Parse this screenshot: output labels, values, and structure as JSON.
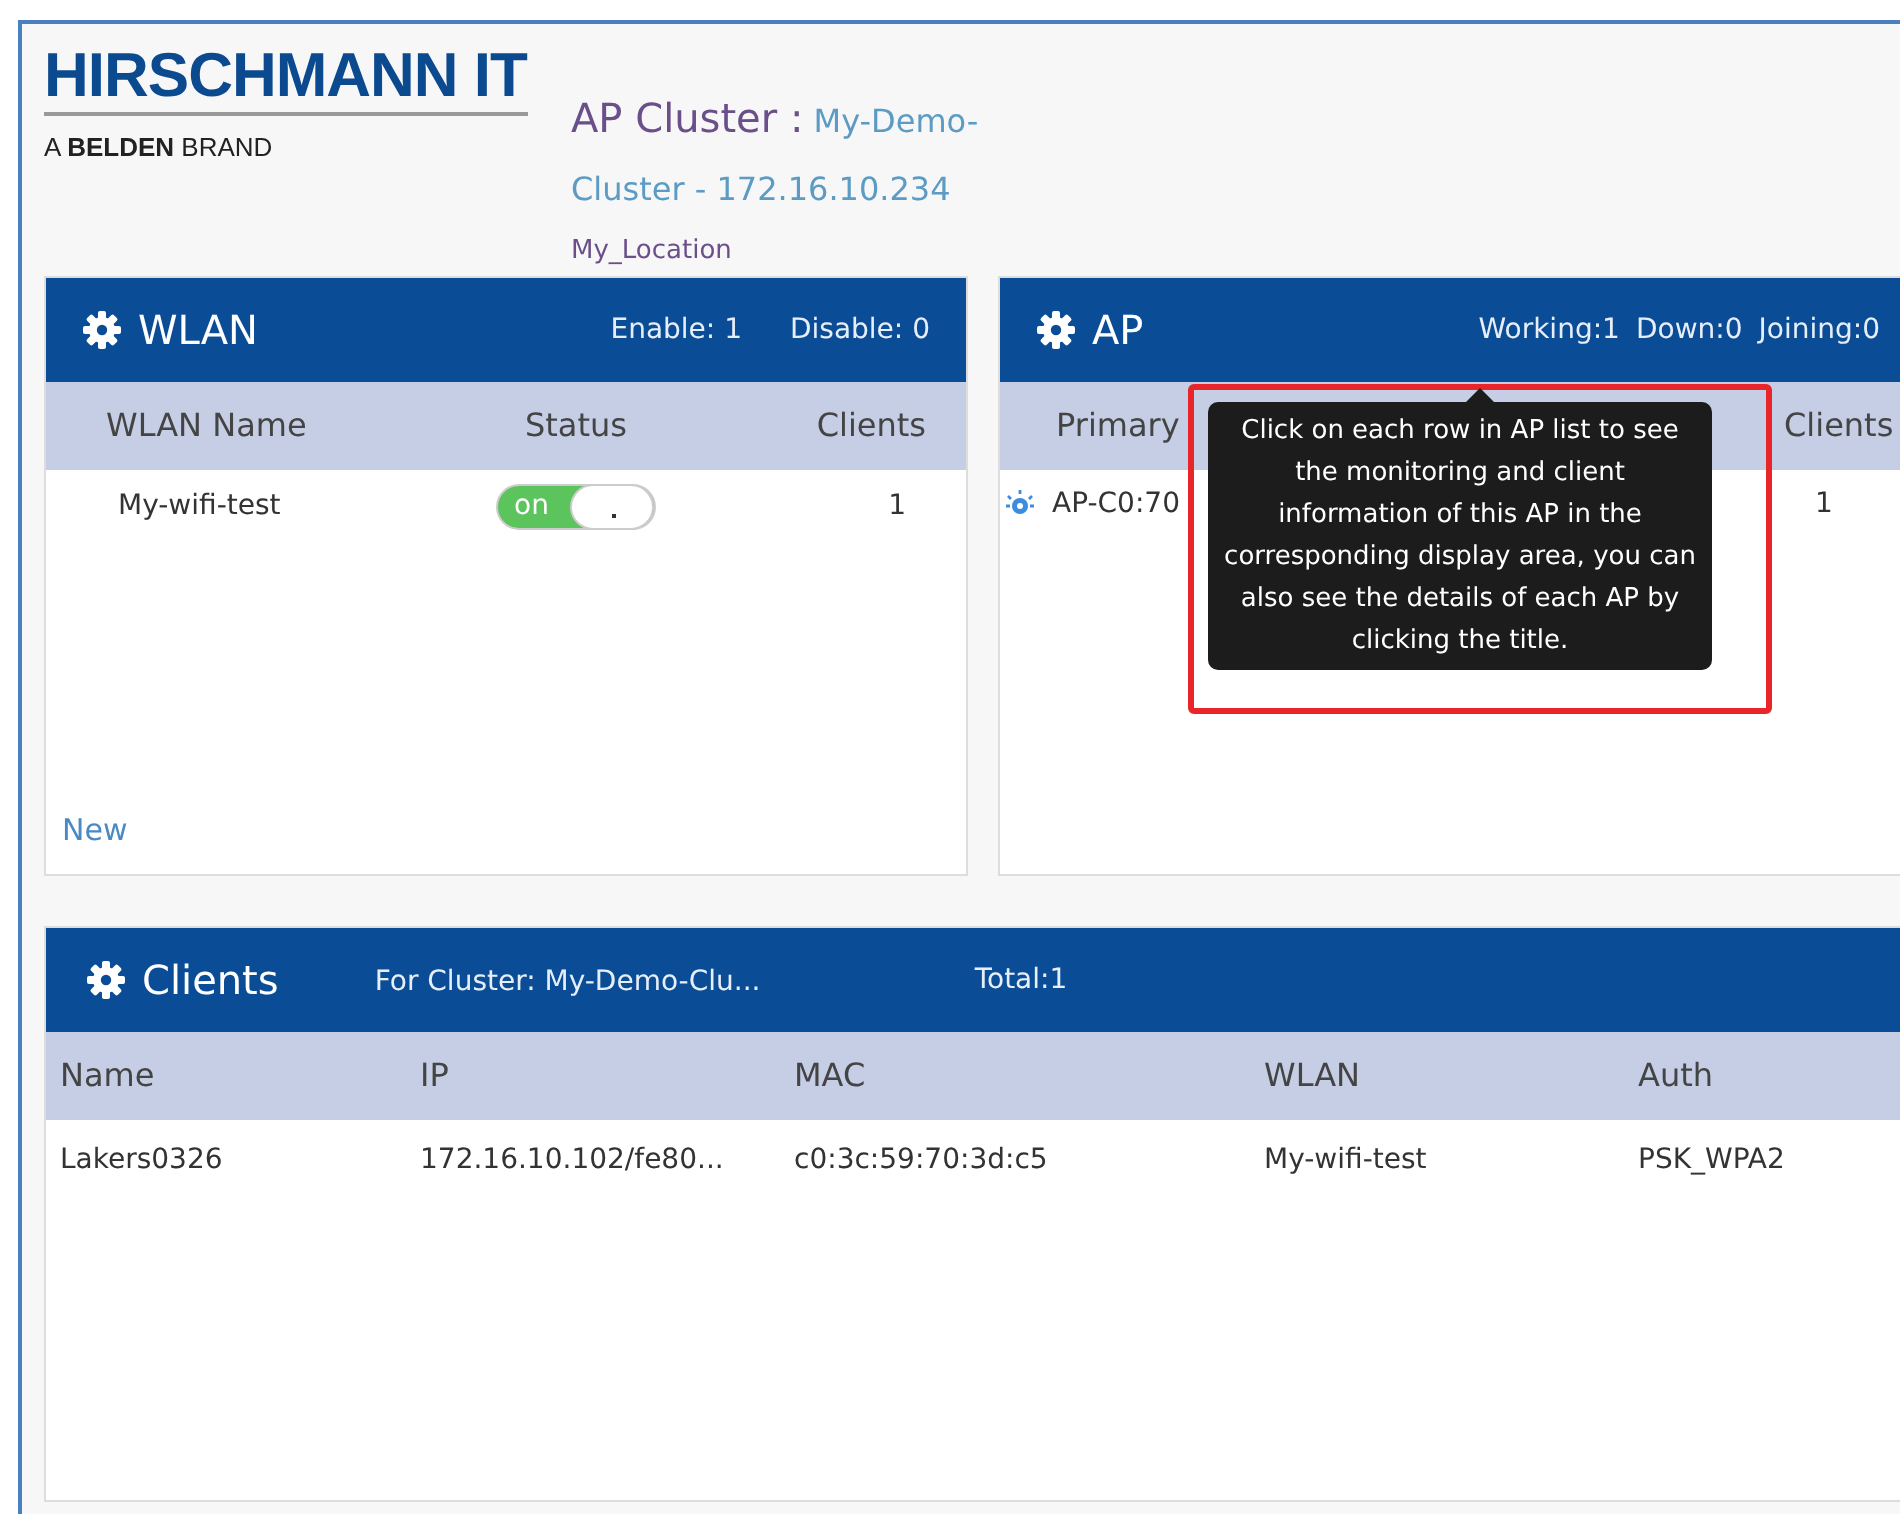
{
  "logo": {
    "title": "HIRSCHMANN IT",
    "tagline": "A **BELDEN** BRAND"
  },
  "header": {
    "label": "AP Cluster :",
    "cluster": "My-Demo-Cluster - 172.16.10.234",
    "location": "My_Location"
  },
  "wlan": {
    "title": "WLAN",
    "stats": [
      "Enable: 1",
      "Disable: 0"
    ],
    "columns": [
      "WLAN Name",
      "Status",
      "Clients"
    ],
    "rows": [
      {
        "name": "My-wifi-test",
        "status": "on",
        "on": true,
        "clients": "1"
      }
    ],
    "new_link": "New"
  },
  "ap": {
    "title": "AP",
    "stats": [
      "Working:1",
      "Down:0",
      "Joining:0"
    ],
    "columns": [
      "Primary",
      "Clients"
    ],
    "rows": [
      {
        "name": "AP-C0:70",
        "clients": "1"
      }
    ],
    "tooltip": "Click on each row in AP list to see the monitoring and client information of this AP in the corresponding display area, you can also see the details of each AP by clicking the title."
  },
  "clients": {
    "title": "Clients",
    "stats": [
      "For Cluster: My-Demo-Clu...",
      "Total:1"
    ],
    "columns": [
      "Name",
      "IP",
      "MAC",
      "WLAN",
      "Auth"
    ],
    "rows": [
      {
        "cells": [
          "Lakers0326",
          "172.16.10.102/fe80...",
          "c0:3c:59:70:3d:c5",
          "My-wifi-test",
          "PSK_WPA2"
        ]
      }
    ]
  }
}
